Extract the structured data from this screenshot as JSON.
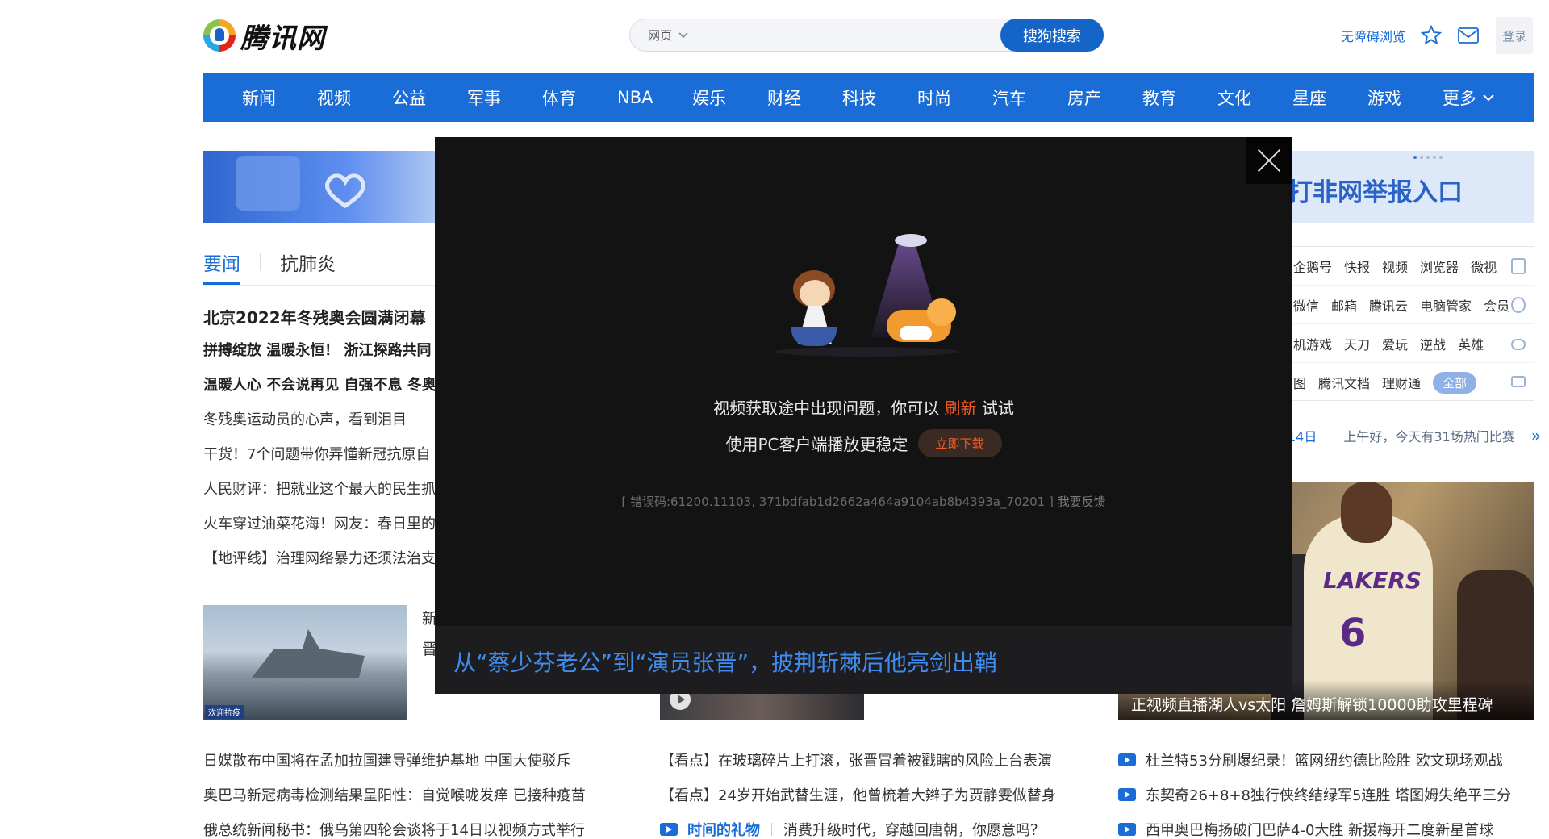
{
  "header": {
    "logo_text": "腾讯网",
    "search_type": "网页",
    "search_placeholder": "",
    "search_button": "搜狗搜索",
    "accessibility_link": "无障碍浏览",
    "login": "登录"
  },
  "nav": {
    "items": [
      "新闻",
      "视频",
      "公益",
      "军事",
      "体育",
      "NBA",
      "娱乐",
      "财经",
      "科技",
      "时尚",
      "汽车",
      "房产",
      "教育",
      "文化",
      "星座",
      "游戏"
    ],
    "more": "更多"
  },
  "banner_right": {
    "text": "打非网举报入口"
  },
  "tabs": {
    "active": "要闻",
    "second": "抗肺炎"
  },
  "news": {
    "headline": "北京2022年冬残奥会圆满闭幕",
    "bold_lines": [
      "拼搏绽放 温暖永恒！ 浙江探路共同",
      "温暖人心 不会说再见 自强不息 冬奥"
    ],
    "lines": [
      "冬残奥运动员的心声，看到泪目",
      "干货！7个问题带你弄懂新冠抗原自",
      "人民财评：把就业这个最大的民生抓",
      "火车穿过油菜花海！网友：春日里的",
      "【地评线】治理网络暴力还须法治支"
    ]
  },
  "image_left": {
    "caption": "欢迎抗疫"
  },
  "side_text": [
    "新",
    "晋"
  ],
  "image_right": {
    "caption": "正视频直播湖人vs太阳 詹姆斯解锁10000助攻里程碑"
  },
  "services": {
    "row1": [
      "企鹅号",
      "快报",
      "视频",
      "浏览器",
      "微视"
    ],
    "row2": [
      "微信",
      "邮箱",
      "腾讯云",
      "电脑管家",
      "会员"
    ],
    "row3": [
      "机游戏",
      "天刀",
      "爱玩",
      "逆战",
      "英雄"
    ],
    "row4": [
      "图",
      "腾讯文档",
      "理财通"
    ],
    "all_pill": "全部"
  },
  "sports": {
    "date": "14日",
    "text": "上午好，今天有31场热门比赛"
  },
  "lists": {
    "left": [
      "日媒散布中国将在孟加拉国建导弹维护基地 中国大使驳斥",
      "奥巴马新冠病毒检测结果呈阳性：自觉喉咙发痒 已接种疫苗",
      "俄总统新闻秘书：俄乌第四轮会谈将于14日以视频方式举行"
    ],
    "mid": [
      "【看点】在玻璃碎片上打滚，张晋冒着被戳瞎的风险上台表演",
      "【看点】24岁开始武替生涯，他曾梳着大辫子为贾静雯做替身"
    ],
    "mid_gift_title": "时间的礼物",
    "mid_gift_text": "消费升级时代，穿越回唐朝，你愿意吗？",
    "right": [
      "杜兰特53分刷爆纪录！篮网纽约德比险胜 欧文现场观战",
      "东契奇26+8+8独行侠终结绿军5连胜 塔图姆失绝平三分",
      "西甲奥巴梅扬破门巴萨4-0大胜 新援梅开二度新星首球"
    ]
  },
  "modal": {
    "msg_prefix": "视频获取途中出现问题，你可以",
    "refresh": "刷新",
    "msg_suffix": "试试",
    "pc_msg": "使用PC客户端播放更稳定",
    "download_btn": "立即下载",
    "error": "[ 错误码:61200.11103, 371bdfab1d2662a464a9104ab8b4393a_70201 ]",
    "feedback": "我要反馈",
    "caption": "从“蔡少芬老公”到“演员张晋”，披荆斩棘后他亮剑出鞘"
  }
}
